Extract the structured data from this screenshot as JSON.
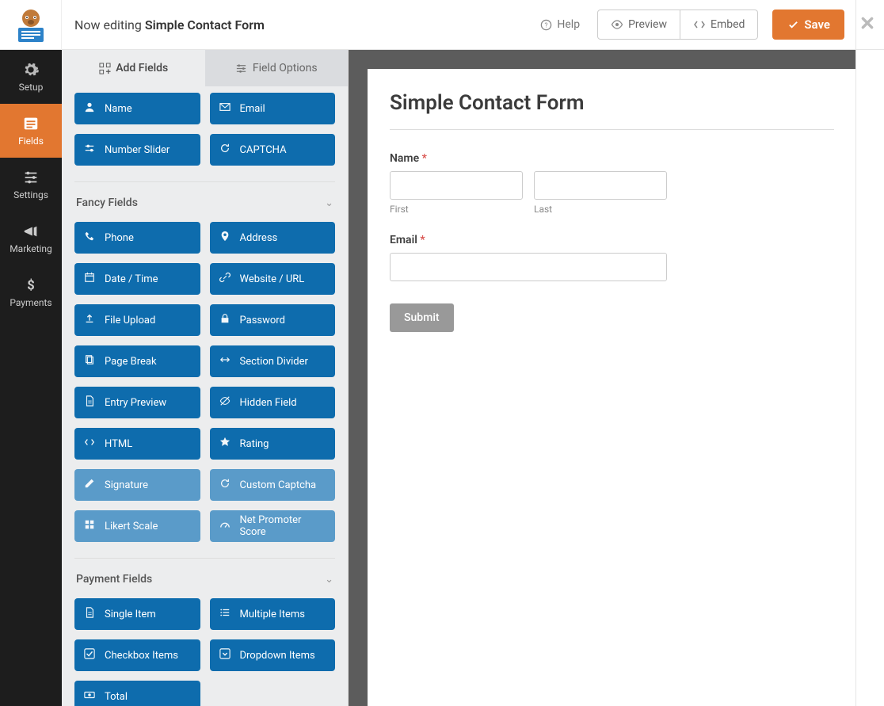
{
  "header": {
    "nowEditing": "Now editing",
    "formName": "Simple Contact Form",
    "help": "Help",
    "preview": "Preview",
    "embed": "Embed",
    "save": "Save"
  },
  "rail": [
    {
      "key": "setup",
      "label": "Setup"
    },
    {
      "key": "fields",
      "label": "Fields"
    },
    {
      "key": "settings",
      "label": "Settings"
    },
    {
      "key": "marketing",
      "label": "Marketing"
    },
    {
      "key": "payments",
      "label": "Payments"
    }
  ],
  "sideTabs": {
    "add": "Add Fields",
    "options": "Field Options"
  },
  "topFields": [
    {
      "label": "Name",
      "icon": "user"
    },
    {
      "label": "Email",
      "icon": "mail"
    },
    {
      "label": "Number Slider",
      "icon": "sliders"
    },
    {
      "label": "CAPTCHA",
      "icon": "refresh"
    }
  ],
  "groups": [
    {
      "title": "Fancy Fields",
      "items": [
        {
          "label": "Phone",
          "icon": "phone"
        },
        {
          "label": "Address",
          "icon": "pin"
        },
        {
          "label": "Date / Time",
          "icon": "calendar"
        },
        {
          "label": "Website / URL",
          "icon": "link"
        },
        {
          "label": "File Upload",
          "icon": "upload"
        },
        {
          "label": "Password",
          "icon": "lock"
        },
        {
          "label": "Page Break",
          "icon": "copy"
        },
        {
          "label": "Section Divider",
          "icon": "arrows"
        },
        {
          "label": "Entry Preview",
          "icon": "doc"
        },
        {
          "label": "Hidden Field",
          "icon": "eye-off"
        },
        {
          "label": "HTML",
          "icon": "code"
        },
        {
          "label": "Rating",
          "icon": "star"
        },
        {
          "label": "Signature",
          "icon": "pencil",
          "muted": true
        },
        {
          "label": "Custom Captcha",
          "icon": "refresh",
          "muted": true
        },
        {
          "label": "Likert Scale",
          "icon": "grid",
          "muted": true
        },
        {
          "label": "Net Promoter Score",
          "icon": "gauge",
          "muted": true
        }
      ]
    },
    {
      "title": "Payment Fields",
      "items": [
        {
          "label": "Single Item",
          "icon": "doc"
        },
        {
          "label": "Multiple Items",
          "icon": "list"
        },
        {
          "label": "Checkbox Items",
          "icon": "check"
        },
        {
          "label": "Dropdown Items",
          "icon": "caret"
        },
        {
          "label": "Total",
          "icon": "money"
        }
      ]
    }
  ],
  "form": {
    "title": "Simple Contact Form",
    "nameLabel": "Name",
    "first": "First",
    "last": "Last",
    "emailLabel": "Email",
    "submit": "Submit"
  }
}
